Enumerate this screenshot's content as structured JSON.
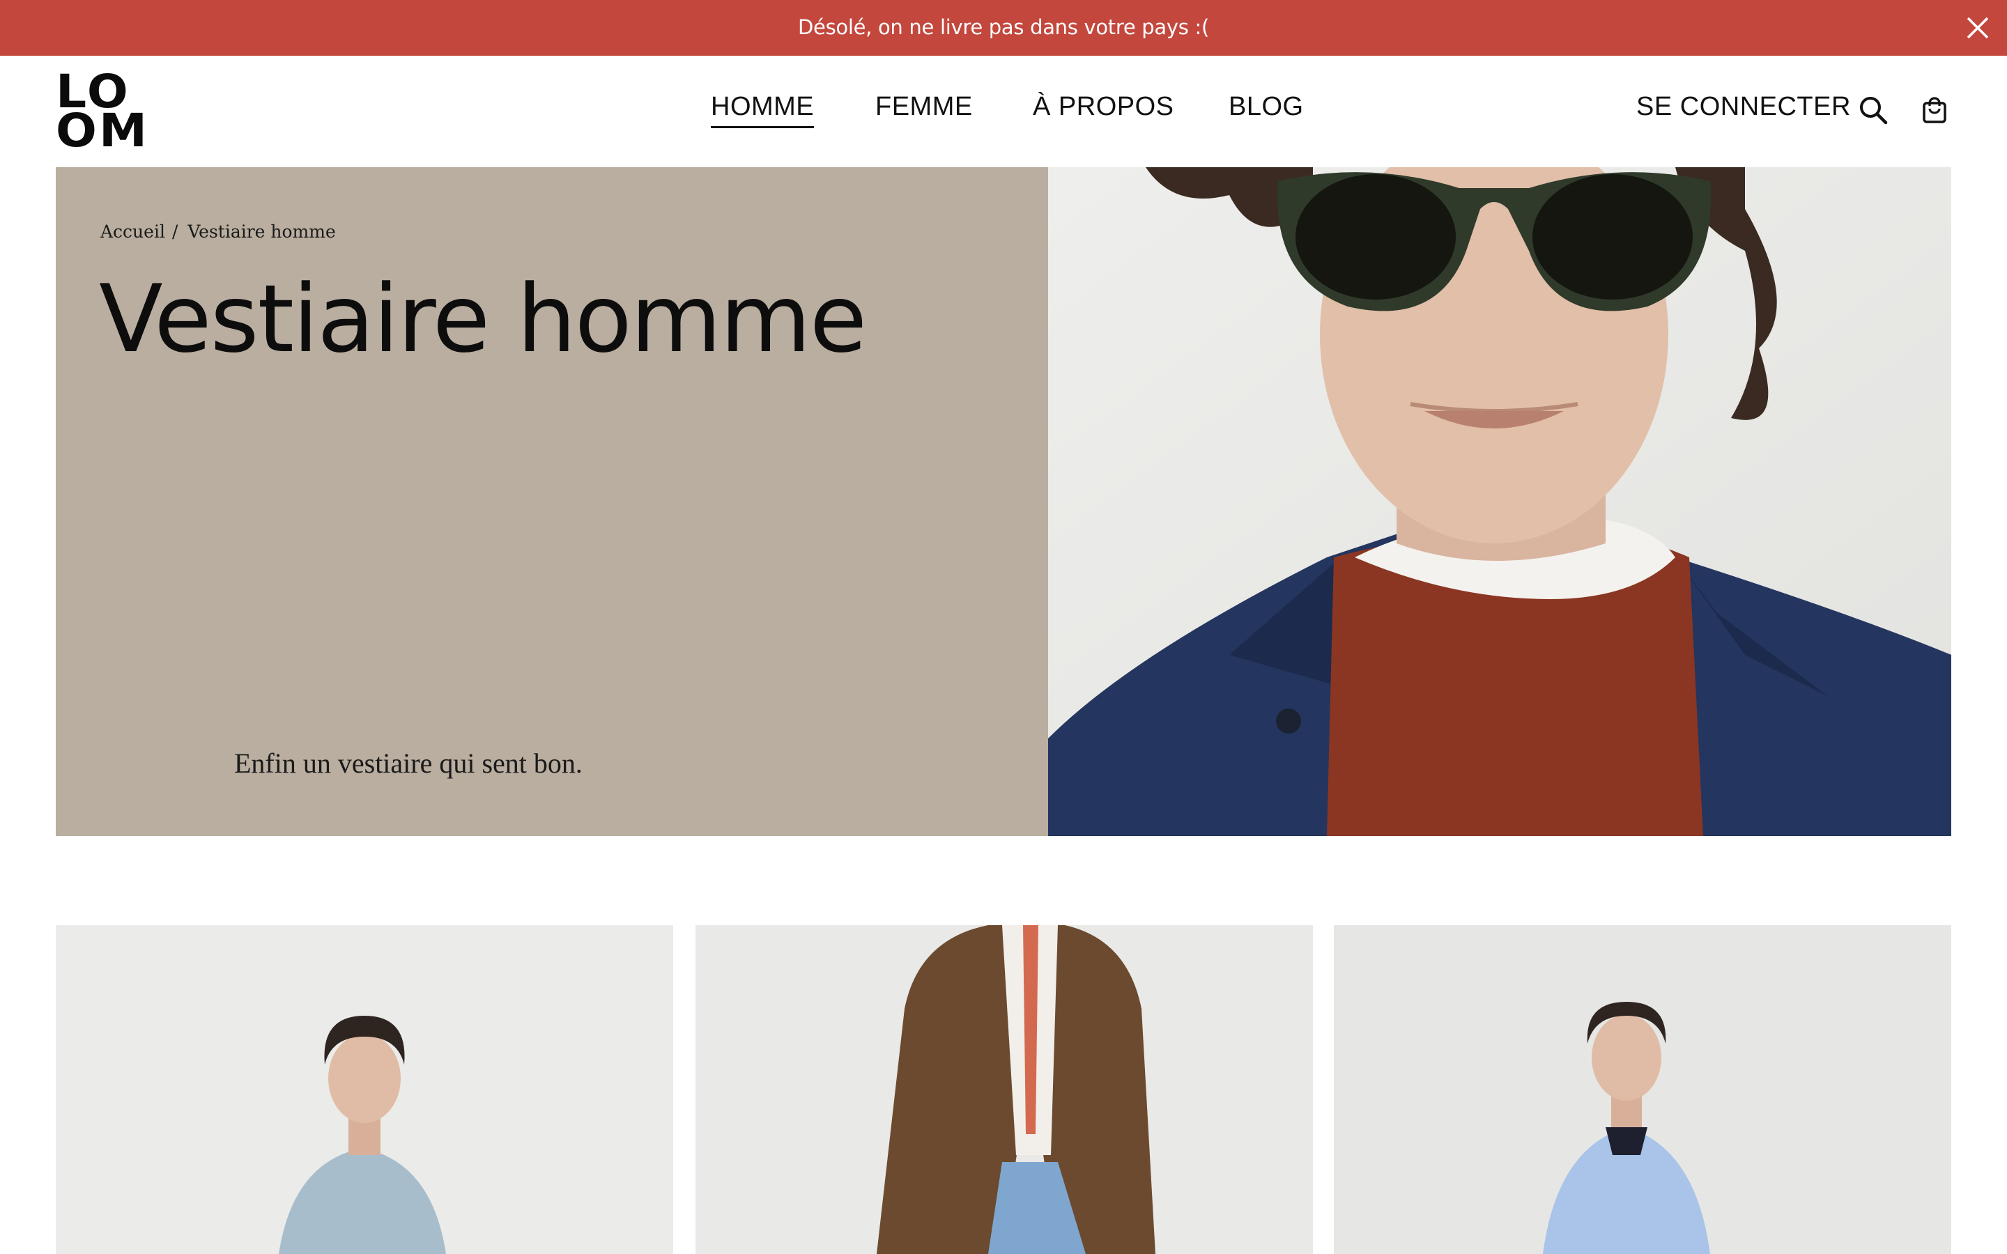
{
  "banner": {
    "message": "Désolé, on ne livre pas dans votre pays :(",
    "bg_color": "#c3473d",
    "close_icon": "close-icon"
  },
  "header": {
    "logo": {
      "line1": "LO",
      "line2": "OM"
    },
    "nav": [
      {
        "label": "HOMME",
        "active": true
      },
      {
        "label": "FEMME",
        "active": false
      },
      {
        "label": "À PROPOS",
        "active": false
      },
      {
        "label": "BLOG",
        "active": false
      }
    ],
    "login_label": "SE CONNECTER",
    "icons": [
      "search-icon",
      "shopping-bag-icon"
    ]
  },
  "hero": {
    "breadcrumb": [
      "Accueil",
      "Vestiaire homme"
    ],
    "breadcrumb_separator": "/",
    "title": "Vestiaire homme",
    "tagline": "Enfin un vestiaire qui sent bon.",
    "panel_color": "#b9ae9f"
  }
}
